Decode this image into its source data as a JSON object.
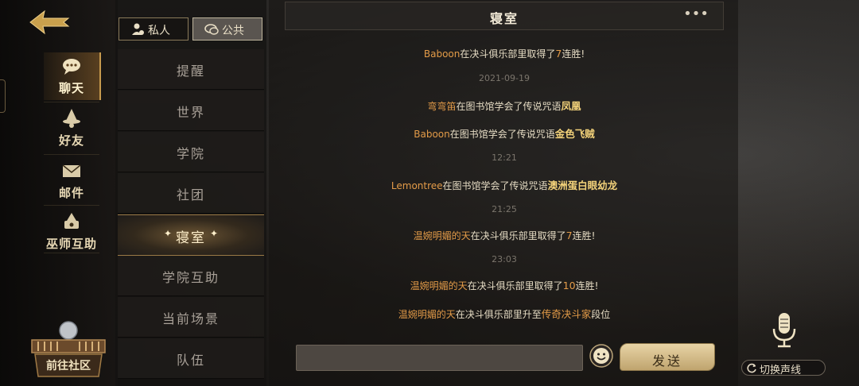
{
  "left_nav": {
    "items": [
      {
        "label": "聊天",
        "active": true
      },
      {
        "label": "好友",
        "active": false
      },
      {
        "label": "邮件",
        "active": false
      },
      {
        "label": "巫师互助",
        "active": false
      }
    ],
    "community_label": "前往社区"
  },
  "toggles": {
    "private_label": "私人",
    "public_label": "公共"
  },
  "channels": [
    {
      "label": "提醒",
      "active": false
    },
    {
      "label": "世界",
      "active": false
    },
    {
      "label": "学院",
      "active": false
    },
    {
      "label": "社团",
      "active": false
    },
    {
      "label": "寝室",
      "active": true
    },
    {
      "label": "学院互助",
      "active": false
    },
    {
      "label": "当前场景",
      "active": false
    },
    {
      "label": "队伍",
      "active": false
    }
  ],
  "chat": {
    "title": "寝室",
    "more_label": "•••",
    "messages": [
      {
        "name": "Baboon",
        "text": "在决斗俱乐部里取得了",
        "highlight": "7",
        "suffix": "连胜!"
      },
      {
        "timestamp": "2021-09-19"
      },
      {
        "name": "弯弯笛",
        "text": "在图书馆学会了传说咒语",
        "highlight": "凤凰",
        "suffix": ""
      },
      {
        "name": "Baboon",
        "text": "在图书馆学会了传说咒语",
        "highlight": "金色飞贼",
        "suffix": ""
      },
      {
        "timestamp": "12:21"
      },
      {
        "name": "Lemontree",
        "text": "在图书馆学会了传说咒语",
        "highlight": "澳洲蛋白眼幼龙",
        "suffix": ""
      },
      {
        "timestamp": "21:25"
      },
      {
        "name": "温婉明媚的天",
        "text": "在决斗俱乐部里取得了",
        "highlight": "7",
        "suffix": "连胜!"
      },
      {
        "timestamp": "23:03"
      },
      {
        "name": "温婉明媚的天",
        "text": "在决斗俱乐部里取得了",
        "highlight": "10",
        "suffix": "连胜!"
      },
      {
        "name": "温婉明媚的天",
        "text": "在决斗俱乐部里升至",
        "highlight": "传奇决斗家",
        "suffix": "段位"
      }
    ]
  },
  "composer": {
    "input_value": "",
    "send_label": "发送"
  },
  "voice": {
    "switch_label": "切换声线"
  },
  "colors": {
    "accent_gold": "#c79a4e",
    "name_orange": "#e39b48",
    "highlight_gold": "#f3d27a"
  }
}
